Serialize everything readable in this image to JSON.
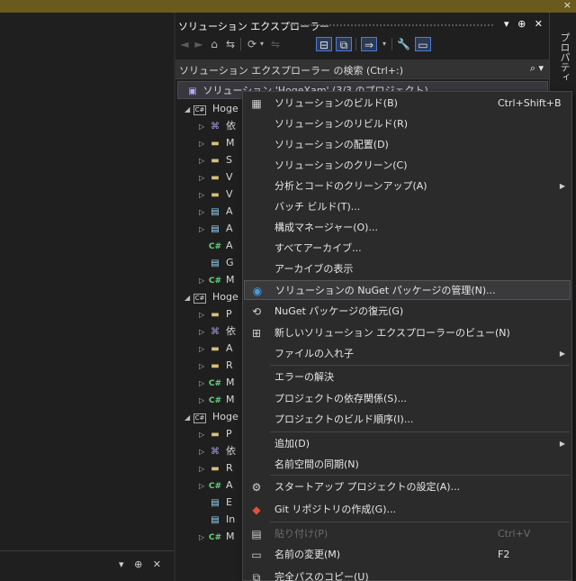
{
  "topbar": {
    "close": "×"
  },
  "left_panel": {
    "bottom_controls": "▾ ⊕ ✕"
  },
  "solution_explorer": {
    "title": "ソリューション エクスプローラー",
    "title_controls": "▾ ⊕ ✕",
    "search_placeholder": "ソリューション エクスプローラー の検索 (Ctrl+:)",
    "search_icon": "⌕ ▾",
    "toolbar": [
      "◄",
      "►",
      "⌂",
      "⇆",
      "⟳",
      "▾",
      "⇋",
      "⊟",
      "⧉",
      "⇒",
      "▾",
      "🔧",
      "▭"
    ],
    "solution_label": "ソリューション 'HogeXam' (3/3 のプロジェクト)",
    "tree": [
      {
        "type": "project",
        "label": "Hoge"
      },
      {
        "type": "ref",
        "label": "依"
      },
      {
        "type": "folder",
        "label": "M"
      },
      {
        "type": "folder",
        "label": "S"
      },
      {
        "type": "folder",
        "label": "V"
      },
      {
        "type": "folder",
        "label": "V"
      },
      {
        "type": "file",
        "label": "A"
      },
      {
        "type": "file",
        "label": "A"
      },
      {
        "type": "cs",
        "label": "A"
      },
      {
        "type": "file",
        "label": "G"
      },
      {
        "type": "cs",
        "label": "M"
      },
      {
        "type": "project",
        "label": "Hoge"
      },
      {
        "type": "folder",
        "label": "P"
      },
      {
        "type": "ref",
        "label": "依"
      },
      {
        "type": "folder",
        "label": "A"
      },
      {
        "type": "folder",
        "label": "R"
      },
      {
        "type": "cs",
        "label": "M"
      },
      {
        "type": "cs",
        "label": "M"
      },
      {
        "type": "project",
        "label": "Hoge"
      },
      {
        "type": "folder",
        "label": "P"
      },
      {
        "type": "ref",
        "label": "依"
      },
      {
        "type": "folder",
        "label": "R"
      },
      {
        "type": "cs",
        "label": "A"
      },
      {
        "type": "file",
        "label": "E"
      },
      {
        "type": "file",
        "label": "In"
      },
      {
        "type": "cs",
        "label": "M"
      }
    ]
  },
  "properties_tab": {
    "label": "プロパティ"
  },
  "context_menu": {
    "items": [
      {
        "icon": "▦",
        "label": "ソリューションのビルド(B)",
        "shortcut": "Ctrl+Shift+B"
      },
      {
        "icon": "",
        "label": "ソリューションのリビルド(R)"
      },
      {
        "icon": "",
        "label": "ソリューションの配置(D)"
      },
      {
        "icon": "",
        "label": "ソリューションのクリーン(C)"
      },
      {
        "icon": "",
        "label": "分析とコードのクリーンアップ(A)",
        "submenu": true
      },
      {
        "icon": "",
        "label": "バッチ ビルド(T)..."
      },
      {
        "icon": "",
        "label": "構成マネージャー(O)..."
      },
      {
        "icon": "",
        "label": "すべてアーカイブ..."
      },
      {
        "icon": "",
        "label": "アーカイブの表示"
      },
      {
        "icon": "◉",
        "label": "ソリューションの NuGet パッケージの管理(N)...",
        "hover": true
      },
      {
        "icon": "⟲",
        "label": "NuGet パッケージの復元(G)"
      },
      {
        "icon": "⊞",
        "label": "新しいソリューション エクスプローラーのビュー(N)"
      },
      {
        "icon": "",
        "label": "ファイルの入れ子",
        "submenu": true
      },
      {
        "icon": "",
        "label": "エラーの解決"
      },
      {
        "icon": "",
        "label": "プロジェクトの依存関係(S)..."
      },
      {
        "icon": "",
        "label": "プロジェクトのビルド順序(I)..."
      },
      {
        "icon": "",
        "label": "追加(D)",
        "submenu": true
      },
      {
        "icon": "",
        "label": "名前空間の同期(N)"
      },
      {
        "icon": "⚙",
        "label": "スタートアップ プロジェクトの設定(A)..."
      },
      {
        "icon": "◆",
        "label": "Git リポジトリの作成(G)..."
      },
      {
        "icon": "▤",
        "label": "貼り付け(P)",
        "shortcut": "Ctrl+V",
        "disabled": true
      },
      {
        "icon": "▭",
        "label": "名前の変更(M)",
        "shortcut": "F2"
      },
      {
        "icon": "⧉",
        "label": "完全パスのコピー(U)"
      }
    ],
    "submenu_arrow": "▶"
  }
}
